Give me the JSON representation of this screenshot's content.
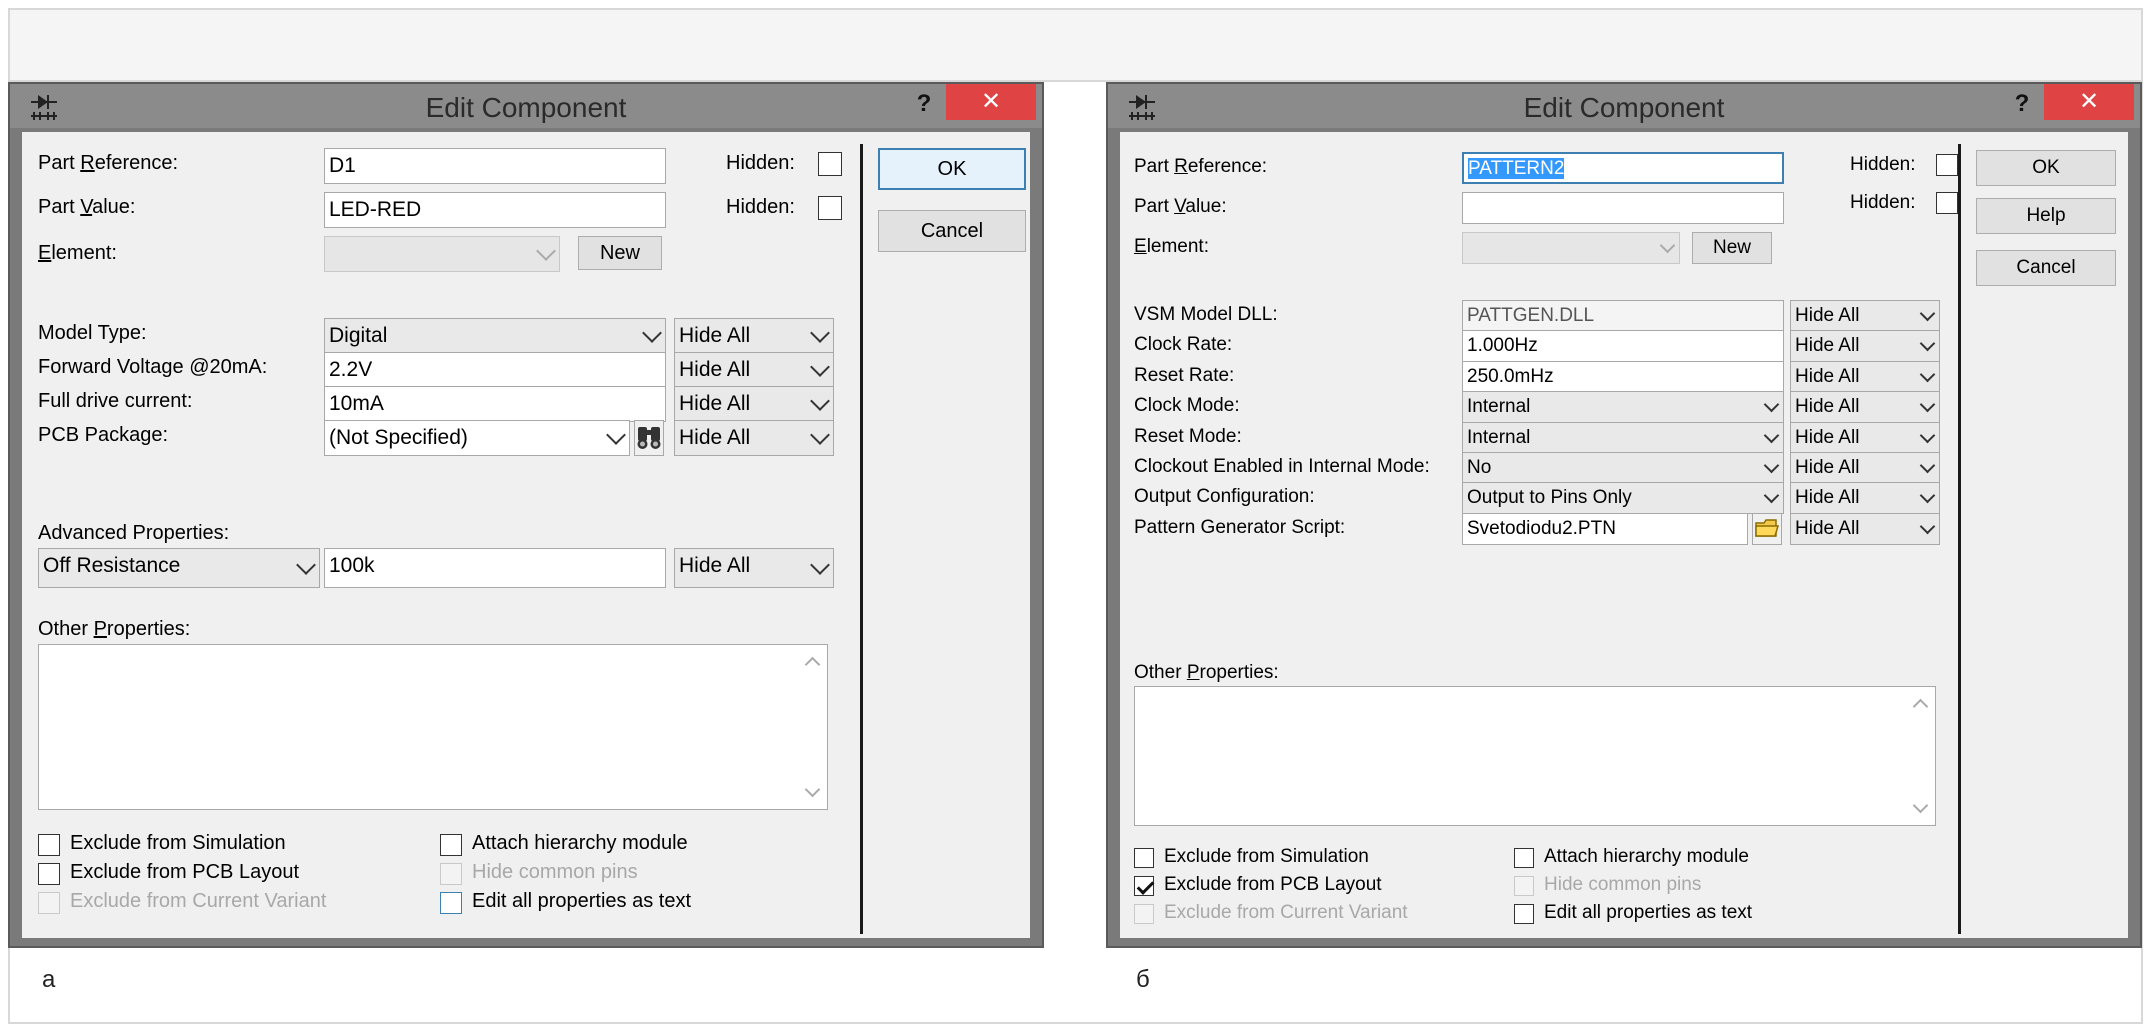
{
  "left": {
    "title": "Edit Component",
    "help": "?",
    "close": "✕",
    "part_reference_pre": "Part ",
    "part_reference_ul": "R",
    "part_reference_post": "eference:",
    "part_reference_value": "D1",
    "hidden1": "Hidden:",
    "part_value_pre": "Part ",
    "part_value_ul": "V",
    "part_value_post": "alue:",
    "part_value_value": "LED-RED",
    "hidden2": "Hidden:",
    "element_ul": "E",
    "element_post": "lement:",
    "new_button": "New",
    "ok_button": "OK",
    "cancel_button": "Cancel",
    "properties": [
      {
        "label": "Model Type:",
        "value": "Digital",
        "kind": "combo",
        "vis": "Hide All"
      },
      {
        "label": "Forward Voltage @20mA:",
        "value": "2.2V",
        "kind": "text",
        "vis": "Hide All"
      },
      {
        "label": "Full drive current:",
        "value": "10mA",
        "kind": "text",
        "vis": "Hide All"
      },
      {
        "label": "PCB Package:",
        "value": "(Not Specified)",
        "kind": "combo-pkg",
        "vis": "Hide All"
      }
    ],
    "advanced_label": "Advanced Properties:",
    "advanced_select": "Off Resistance",
    "advanced_value": "100k",
    "advanced_vis": "Hide All",
    "other_pre": "Other ",
    "other_ul": "P",
    "other_post": "roperties:",
    "options": {
      "exclude_sim": "Exclude from Simulation",
      "exclude_pcb": "Exclude from PCB Layout",
      "exclude_variant": "Exclude from Current Variant",
      "attach_hier": "Attach hierarchy module",
      "hide_pins": "Hide common pins",
      "edit_text": "Edit all properties as text"
    },
    "panel_label": "а"
  },
  "right": {
    "title": "Edit Component",
    "help": "?",
    "close": "✕",
    "part_reference_pre": "Part ",
    "part_reference_ul": "R",
    "part_reference_post": "eference:",
    "part_reference_value": "PATTERN2",
    "hidden1": "Hidden:",
    "part_value_pre": "Part ",
    "part_value_ul": "V",
    "part_value_post": "alue:",
    "part_value_value": "",
    "hidden2": "Hidden:",
    "element_ul": "E",
    "element_post": "lement:",
    "new_button": "New",
    "ok_button": "OK",
    "help_button": "Help",
    "cancel_button": "Cancel",
    "properties": [
      {
        "label": "VSM Model DLL:",
        "value": "PATTGEN.DLL",
        "kind": "readonly",
        "vis": "Hide All"
      },
      {
        "label": "Clock Rate:",
        "value": "1.000Hz",
        "kind": "text",
        "vis": "Hide All"
      },
      {
        "label": "Reset Rate:",
        "value": "250.0mHz",
        "kind": "text",
        "vis": "Hide All"
      },
      {
        "label": "Clock Mode:",
        "value": "Internal",
        "kind": "combo",
        "vis": "Hide All"
      },
      {
        "label": "Reset Mode:",
        "value": "Internal",
        "kind": "combo",
        "vis": "Hide All"
      },
      {
        "label": "Clockout Enabled in Internal Mode:",
        "value": "No",
        "kind": "combo",
        "vis": "Hide All"
      },
      {
        "label": "Output Configuration:",
        "value": "Output to Pins Only",
        "kind": "combo",
        "vis": "Hide All"
      },
      {
        "label": "Pattern Generator Script:",
        "value": "Svetodiodu2.PTN",
        "kind": "file",
        "vis": "Hide All"
      }
    ],
    "other_pre": "Other ",
    "other_ul": "P",
    "other_post": "roperties:",
    "options": {
      "exclude_sim": "Exclude from Simulation",
      "exclude_pcb": "Exclude from PCB Layout",
      "exclude_variant": "Exclude from Current Variant",
      "attach_hier": "Attach hierarchy module",
      "hide_pins": "Hide common pins",
      "edit_text": "Edit all properties as text"
    },
    "panel_label": "б"
  }
}
